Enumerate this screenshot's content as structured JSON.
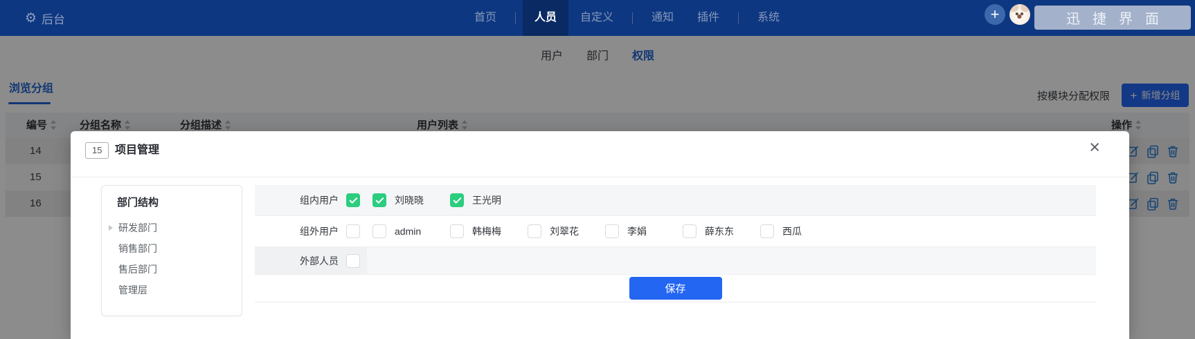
{
  "colors": {
    "topbar_bg": "#0d3781",
    "topbar_active_bg": "#0a2a63",
    "accent_blue": "#2366f2",
    "link_blue": "#2464d4",
    "checkbox_green": "#2bcd7e",
    "action_icon_blue": "#2b7cd3"
  },
  "topbar": {
    "brand_label": "后台",
    "nav": {
      "items": [
        {
          "label": "首页",
          "active": false
        },
        {
          "label": "人员",
          "active": true
        },
        {
          "label": "自定义",
          "active": false
        },
        {
          "label": "通知",
          "active": false
        },
        {
          "label": "插件",
          "active": false
        },
        {
          "label": "系统",
          "active": false
        }
      ]
    },
    "add_button_label": "+",
    "workspace_button_label": "迅捷界面"
  },
  "tabs": {
    "items": [
      {
        "label": "用户",
        "active": false
      },
      {
        "label": "部门",
        "active": false
      },
      {
        "label": "权限",
        "active": true
      }
    ]
  },
  "toolbar": {
    "browse_groups_tab": "浏览分组",
    "assign_by_module": "按模块分配权限",
    "add_group_plus": "+",
    "add_group_label": "新增分组"
  },
  "table": {
    "columns": [
      {
        "label": "编号"
      },
      {
        "label": "分组名称"
      },
      {
        "label": "分组描述"
      },
      {
        "label": "用户列表"
      },
      {
        "label": "操作"
      }
    ],
    "rows": [
      {
        "id": "14",
        "actions": [
          "edit",
          "copy",
          "delete"
        ]
      },
      {
        "id": "15",
        "actions": [
          "edit",
          "copy",
          "delete"
        ]
      },
      {
        "id": "16",
        "actions": [
          "edit",
          "copy",
          "delete"
        ]
      }
    ]
  },
  "modal": {
    "badge": "15",
    "title": "项目管理",
    "close_label": "×",
    "department_panel": {
      "title": "部门结构",
      "items": [
        {
          "label": "研发部门",
          "expandable": true
        },
        {
          "label": "销售部门",
          "expandable": false
        },
        {
          "label": "售后部门",
          "expandable": false
        },
        {
          "label": "管理层",
          "expandable": false
        }
      ]
    },
    "groups": [
      {
        "label": "组内用户",
        "all_checked": true,
        "members": [
          {
            "name": "刘晓晓",
            "checked": true
          },
          {
            "name": "王光明",
            "checked": true
          }
        ]
      },
      {
        "label": "组外用户",
        "all_checked": false,
        "members": [
          {
            "name": "admin",
            "checked": false
          },
          {
            "name": "韩梅梅",
            "checked": false
          },
          {
            "name": "刘翠花",
            "checked": false
          },
          {
            "name": "李娟",
            "checked": false
          },
          {
            "name": "薛东东",
            "checked": false
          },
          {
            "name": "西瓜",
            "checked": false
          }
        ]
      },
      {
        "label": "外部人员",
        "all_checked": false,
        "members": []
      }
    ],
    "save_button": "保存"
  }
}
